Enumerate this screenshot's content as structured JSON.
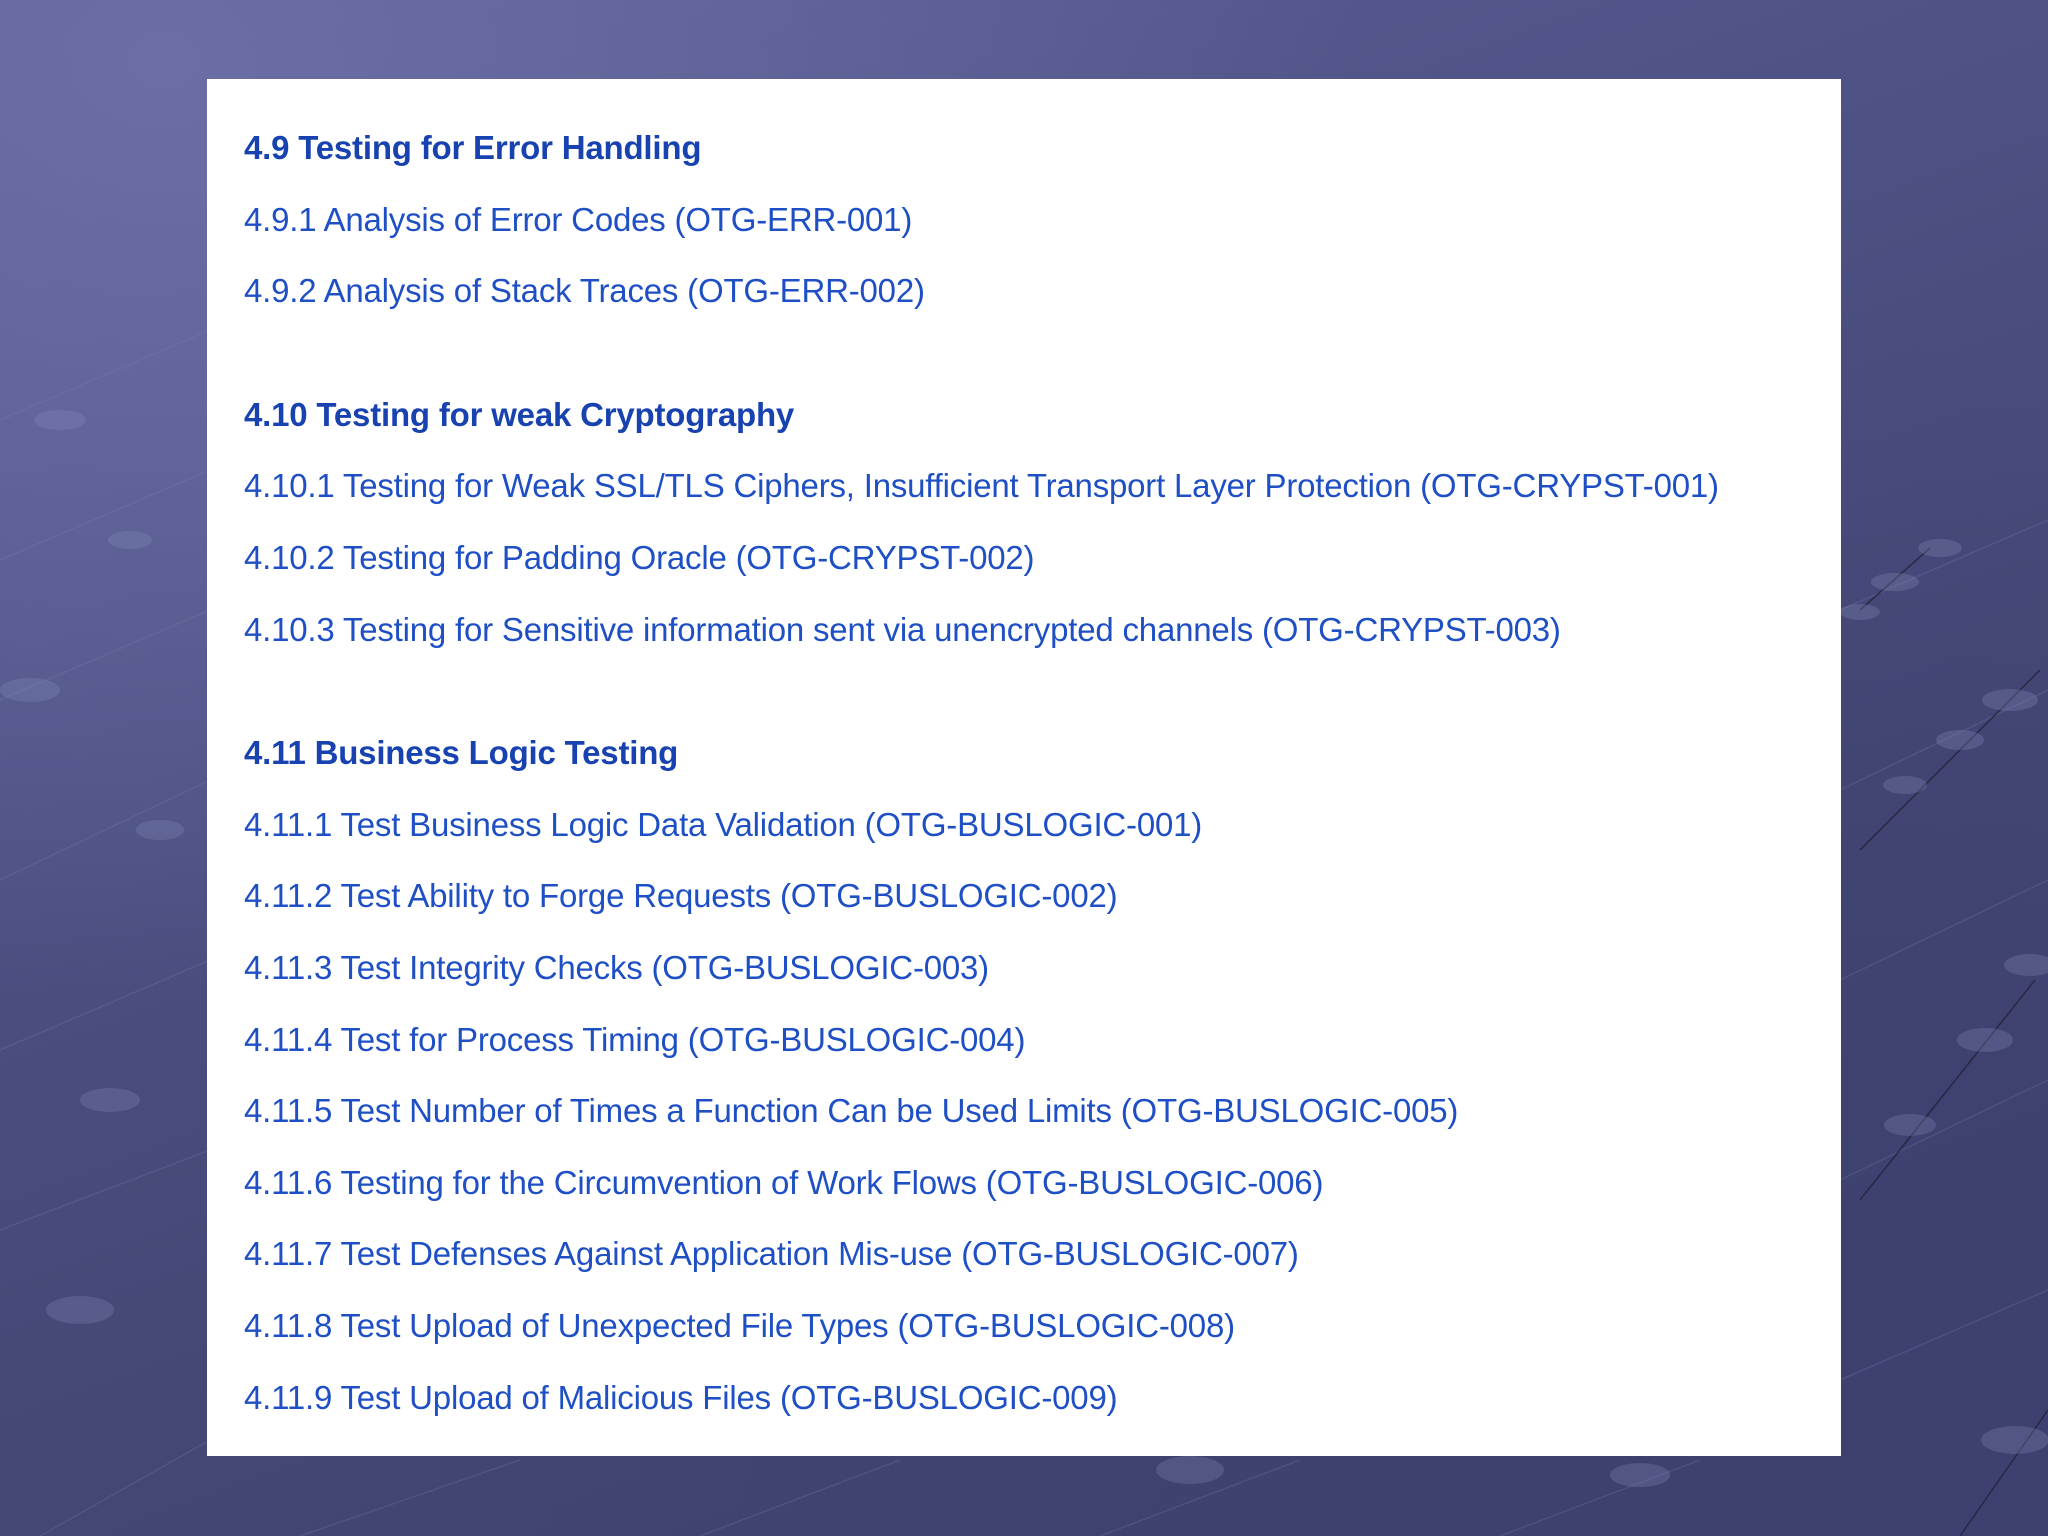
{
  "sections": [
    {
      "heading": "4.9 Testing for Error Handling",
      "items": [
        "4.9.1 Analysis of Error Codes (OTG-ERR-001)",
        "4.9.2 Analysis of Stack Traces (OTG-ERR-002)"
      ]
    },
    {
      "heading": "4.10 Testing for weak Cryptography",
      "items": [
        "4.10.1 Testing for Weak SSL/TLS Ciphers, Insufficient Transport Layer Protection (OTG-CRYPST-001)",
        "4.10.2 Testing for Padding Oracle (OTG-CRYPST-002)",
        "4.10.3 Testing for Sensitive information sent via unencrypted channels (OTG-CRYPST-003)"
      ]
    },
    {
      "heading": "4.11 Business Logic Testing",
      "items": [
        "4.11.1 Test Business Logic Data Validation (OTG-BUSLOGIC-001)",
        "4.11.2 Test Ability to Forge Requests (OTG-BUSLOGIC-002)",
        "4.11.3 Test Integrity Checks (OTG-BUSLOGIC-003)",
        "4.11.4 Test for Process Timing (OTG-BUSLOGIC-004)",
        "4.11.5 Test Number of Times a Function Can be Used Limits (OTG-BUSLOGIC-005)",
        "4.11.6 Testing for the Circumvention of Work Flows (OTG-BUSLOGIC-006)",
        "4.11.7 Test Defenses Against Application Mis-use (OTG-BUSLOGIC-007)",
        "4.11.8 Test Upload of Unexpected File Types (OTG-BUSLOGIC-008)",
        "4.11.9 Test Upload of Malicious Files (OTG-BUSLOGIC-009)"
      ]
    }
  ],
  "colors": {
    "link_text": "#1f4fc4",
    "heading_text": "#1742b0",
    "panel_background": "#ffffff",
    "slide_background": "#4a4d7e"
  }
}
